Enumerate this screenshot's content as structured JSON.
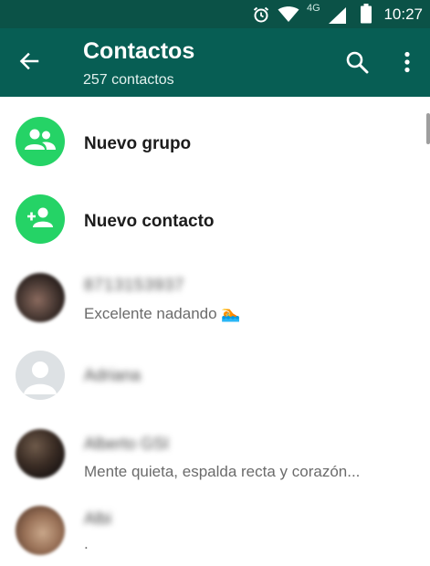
{
  "status_bar": {
    "time": "10:27",
    "network": "4G",
    "icons": [
      "alarm-icon",
      "wifi-icon",
      "signal-icon",
      "battery-icon"
    ]
  },
  "toolbar": {
    "title": "Contactos",
    "subtitle": "257 contactos",
    "back_icon": "arrow-left-icon",
    "search_icon": "search-icon",
    "more_icon": "more-vertical-icon"
  },
  "actions": [
    {
      "label": "Nuevo grupo",
      "icon": "group-icon"
    },
    {
      "label": "Nuevo contacto",
      "icon": "person-add-icon"
    }
  ],
  "contacts": [
    {
      "name": "8713153937",
      "status": "Excelente nadando 🏊",
      "avatar": "photo"
    },
    {
      "name": "Adriana",
      "status": "",
      "avatar": "default"
    },
    {
      "name": "Alberto GSI",
      "status": "Mente quieta, espalda recta y corazón...",
      "avatar": "photo"
    },
    {
      "name": "Albi",
      "status": ".",
      "avatar": "photo"
    }
  ],
  "colors": {
    "status_bar": "#0b5247",
    "toolbar": "#075e54",
    "accent_green": "#25d366"
  }
}
